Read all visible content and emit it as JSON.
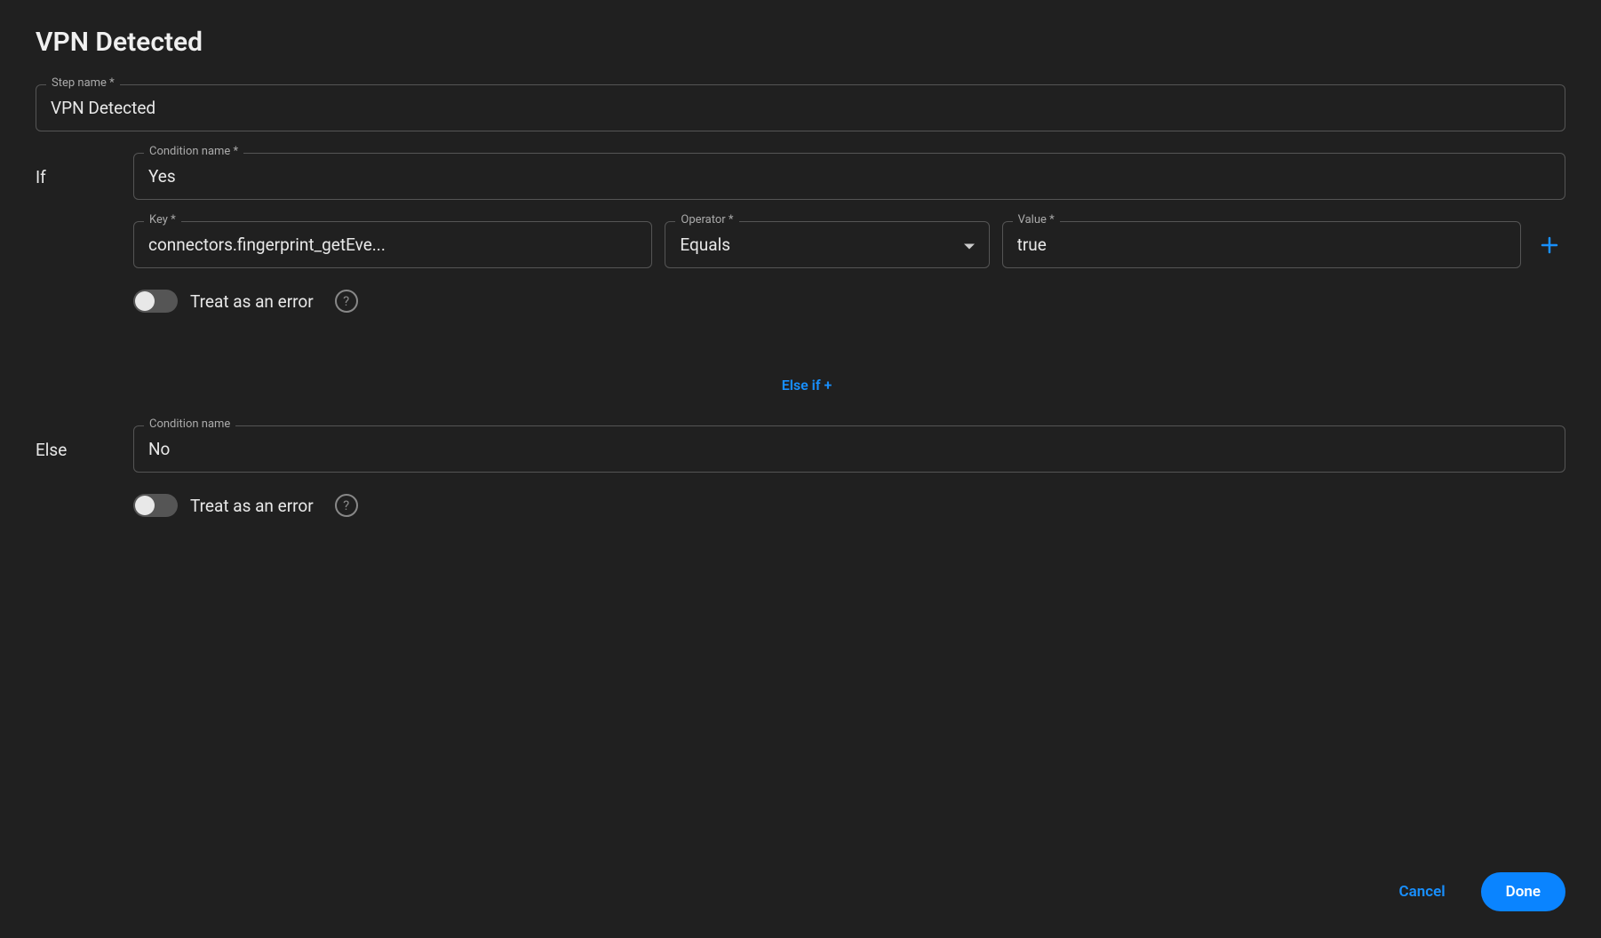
{
  "title": "VPN Detected",
  "step_name": {
    "label": "Step name *",
    "value": "VPN Detected"
  },
  "if_block": {
    "label": "If",
    "condition_name": {
      "label": "Condition name *",
      "value": "Yes"
    },
    "key": {
      "label": "Key *",
      "value": "connectors.fingerprint_getEve..."
    },
    "operator": {
      "label": "Operator *",
      "value": "Equals"
    },
    "value": {
      "label": "Value *",
      "value": "true"
    },
    "treat_as_error": {
      "label": "Treat as an error",
      "checked": false
    }
  },
  "else_if_label": "Else if +",
  "else_block": {
    "label": "Else",
    "condition_name": {
      "label": "Condition name",
      "value": "No"
    },
    "treat_as_error": {
      "label": "Treat as an error",
      "checked": false
    }
  },
  "buttons": {
    "cancel": "Cancel",
    "done": "Done"
  }
}
